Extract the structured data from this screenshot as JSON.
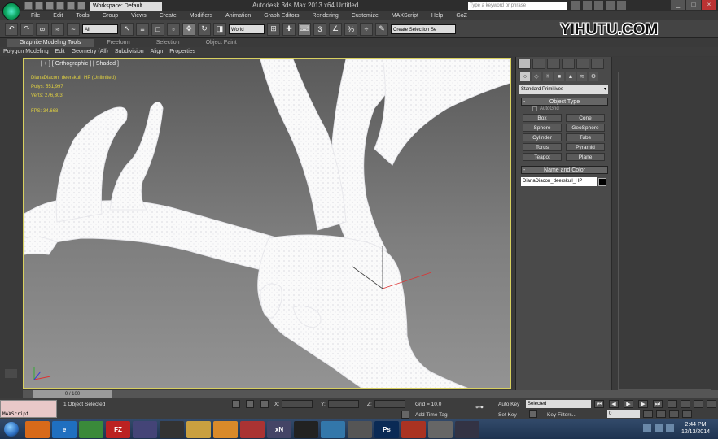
{
  "window": {
    "title": "Autodesk 3ds Max  2013 x64       Untitled",
    "workspace": "Workspace: Default",
    "search_placeholder": "Type a keyword or phrase"
  },
  "watermark": "YIHUTU.COM",
  "menu": [
    "File",
    "Edit",
    "Tools",
    "Group",
    "Views",
    "Create",
    "Modifiers",
    "Animation",
    "Graph Editors",
    "Rendering",
    "Customize",
    "MAXScript",
    "Help",
    "GoZ"
  ],
  "toolbar": {
    "filter_value": "All",
    "coord_system": "World",
    "selection_set_placeholder": "Create Selection Se"
  },
  "ribbon": {
    "tabs": [
      "Graphite Modeling Tools",
      "Freeform",
      "Selection",
      "Object Paint"
    ],
    "active_tab": "Graphite Modeling Tools",
    "subtabs": [
      "Polygon Modeling",
      "Edit",
      "Geometry (All)",
      "Subdivision",
      "Align",
      "Properties"
    ]
  },
  "viewport": {
    "label": "[ + ] [ Orthographic ] [ Shaded ]",
    "stats": {
      "object": "DianaDiacon_deerskull_HP  (Unlimited)",
      "polys_label": "Polys:",
      "polys": "551,997",
      "verts_label": "Verts:",
      "verts": "276,303",
      "fps_label": "FPS:",
      "fps": "34.668"
    }
  },
  "command_panel": {
    "category": "Standard Primitives",
    "object_type_title": "Object Type",
    "autogrid": "AutoGrid",
    "primitives": [
      "Box",
      "Cone",
      "Sphere",
      "GeoSphere",
      "Cylinder",
      "Tube",
      "Torus",
      "Pyramid",
      "Teapot",
      "Plane"
    ],
    "name_color_title": "Name and Color",
    "object_name": "DianaDiacon_deerskull_HP",
    "object_color": "#000000"
  },
  "timeline": {
    "slider": "0 / 100"
  },
  "status": {
    "maxscript": "MAXScript.",
    "selection": "1 Object Selected",
    "x_label": "X:",
    "y_label": "Y:",
    "z_label": "Z:",
    "grid": "Grid = 10.0",
    "add_time_tag": "Add Time Tag",
    "auto_key": "Auto Key",
    "set_key": "Set Key",
    "selected": "Selected",
    "key_filters": "Key Filters...",
    "frame": "0"
  },
  "taskbar": {
    "time": "2:44 PM",
    "date": "12/13/2014",
    "apps": [
      {
        "name": "firefox",
        "label": "",
        "color": "#d86a1a"
      },
      {
        "name": "ie",
        "label": "e",
        "color": "#1f6fc0"
      },
      {
        "name": "chrome",
        "label": "",
        "color": "#3a8a3a"
      },
      {
        "name": "filezilla",
        "label": "FZ",
        "color": "#b22"
      },
      {
        "name": "search",
        "label": "",
        "color": "#447"
      },
      {
        "name": "media",
        "label": "",
        "color": "#333"
      },
      {
        "name": "explorer",
        "label": "",
        "color": "#c9a040"
      },
      {
        "name": "player",
        "label": "",
        "color": "#d98a2a"
      },
      {
        "name": "network",
        "label": "",
        "color": "#a33"
      },
      {
        "name": "xn",
        "label": "xN",
        "color": "#446"
      },
      {
        "name": "zbrush",
        "label": "",
        "color": "#222"
      },
      {
        "name": "monitor",
        "label": "",
        "color": "#37a"
      },
      {
        "name": "cad",
        "label": "",
        "color": "#555"
      },
      {
        "name": "photoshop",
        "label": "Ps",
        "color": "#0a2a55"
      },
      {
        "name": "3dsmax",
        "label": "",
        "color": "#a32"
      },
      {
        "name": "app",
        "label": "",
        "color": "#666"
      },
      {
        "name": "disc",
        "label": "",
        "color": "#334"
      }
    ]
  }
}
